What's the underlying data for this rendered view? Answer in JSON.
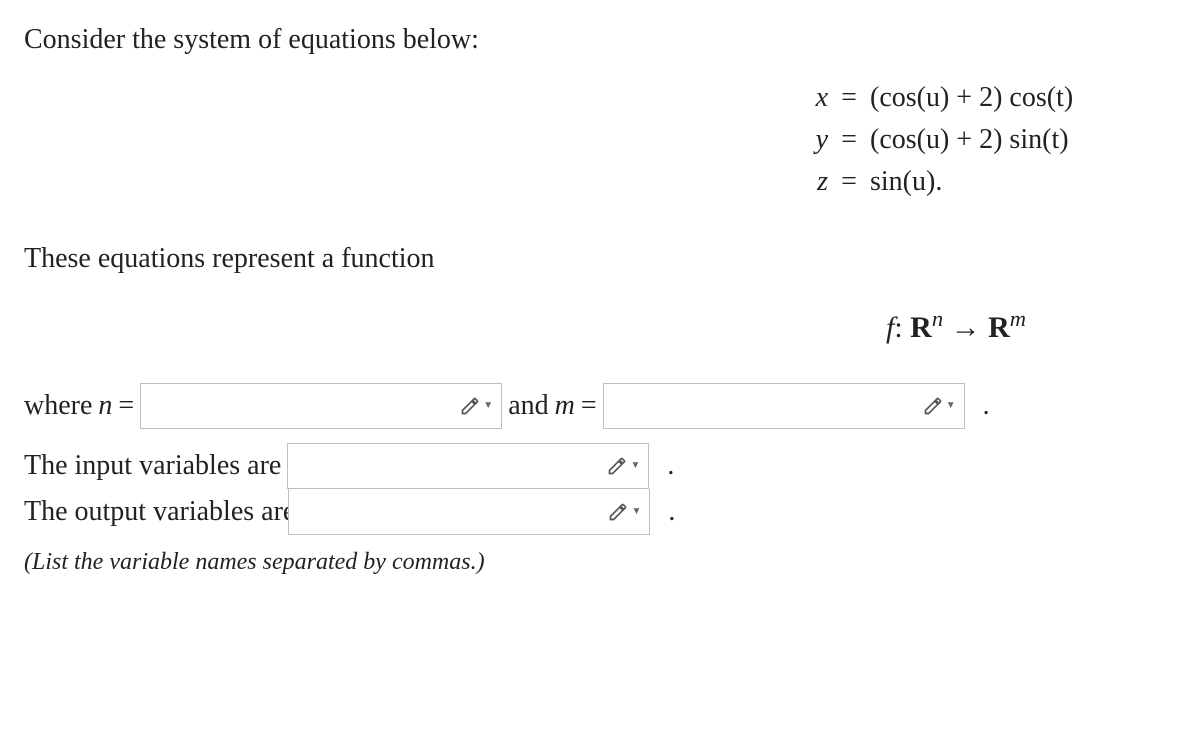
{
  "prompt_intro": "Consider the system of equations below:",
  "equations": {
    "row1": {
      "var": "x",
      "eq": "=",
      "rhs_a": "(cos(",
      "rhs_u": "u",
      "rhs_b": ") + 2) cos(",
      "rhs_t": "t",
      "rhs_c": ")"
    },
    "row2": {
      "var": "y",
      "eq": "=",
      "rhs_a": "(cos(",
      "rhs_u": "u",
      "rhs_b": ") + 2) sin(",
      "rhs_t": "t",
      "rhs_c": ")"
    },
    "row3": {
      "var": "z",
      "eq": "=",
      "rhs_a": "sin(",
      "rhs_u": "u",
      "rhs_b": ")."
    }
  },
  "sentence_function": "These equations represent a function",
  "function_map": {
    "f": "f",
    "colon": ": ",
    "R1": "R",
    "sup_n": "n",
    "arrow": " → ",
    "R2": "R",
    "sup_m": "m"
  },
  "line_nm": {
    "where": "where ",
    "n_var": "n",
    "eq1": " = ",
    "and": " and ",
    "m_var": "m",
    "eq2": " = ",
    "period": "."
  },
  "line_input": {
    "label": "The input variables are",
    "period": "."
  },
  "line_output": {
    "label": "The output variables are",
    "period": "."
  },
  "hint_text": "(List the variable names separated by commas.)",
  "icons": {
    "pencil": "pencil-icon"
  },
  "answers": {
    "n_value": "",
    "m_value": "",
    "input_vars": "",
    "output_vars": ""
  }
}
